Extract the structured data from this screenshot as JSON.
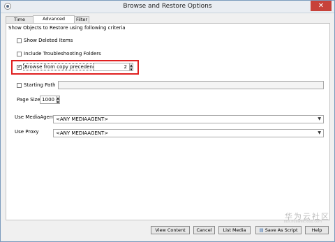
{
  "window": {
    "title": "Browse and Restore Options",
    "close_label": "✕"
  },
  "tabs": [
    {
      "label": "Time Range",
      "active": false
    },
    {
      "label": "Advanced Options",
      "active": true
    },
    {
      "label": "Filter",
      "active": false
    }
  ],
  "panel": {
    "heading": "Show Objects to Restore using following criteria",
    "show_deleted": {
      "label": "Show Deleted Items",
      "checked": false
    },
    "include_troubleshooting": {
      "label": "Include Troubleshooting Folders",
      "checked": false
    },
    "browse_copy": {
      "label": "Browse from copy precedence:",
      "checked": true,
      "value": "2"
    },
    "starting_path": {
      "label": "Starting Path",
      "checked": false,
      "value": ""
    },
    "page_size": {
      "label": "Page Size:",
      "value": "1000"
    },
    "use_media_agent": {
      "label": "Use MediaAgent",
      "value": "<ANY MEDIAAGENT>"
    },
    "use_proxy": {
      "label": "Use Proxy",
      "value": "<ANY MEDIAAGENT>"
    }
  },
  "buttons": {
    "view_content": "View Content",
    "cancel": "Cancel",
    "list_media": "List Media",
    "save_as_script": "Save As Script",
    "help": "Help"
  },
  "watermark": {
    "text": "华为云社区",
    "url": "bbs.huaweicloud.com"
  },
  "colors": {
    "highlight": "#e02020",
    "close": "#c7423a"
  }
}
